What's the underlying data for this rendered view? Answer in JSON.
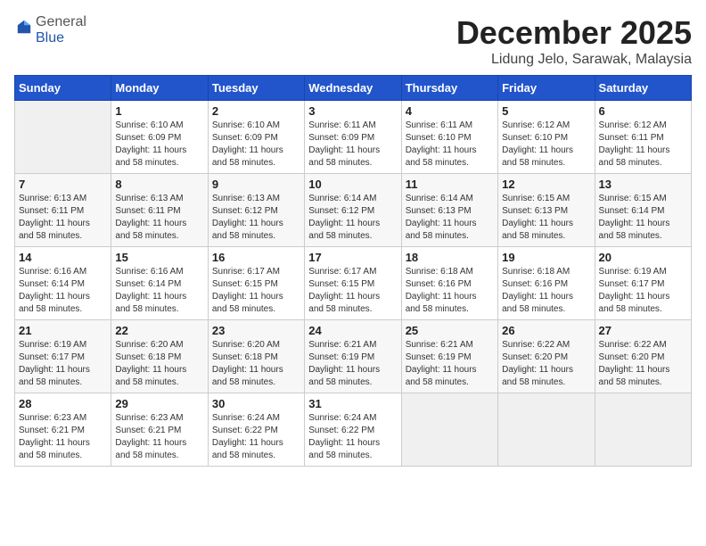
{
  "logo": {
    "general": "General",
    "blue": "Blue"
  },
  "title": "December 2025",
  "location": "Lidung Jelo, Sarawak, Malaysia",
  "days_of_week": [
    "Sunday",
    "Monday",
    "Tuesday",
    "Wednesday",
    "Thursday",
    "Friday",
    "Saturday"
  ],
  "weeks": [
    [
      {
        "day": "",
        "sunrise": "",
        "sunset": "",
        "daylight": ""
      },
      {
        "day": "1",
        "sunrise": "Sunrise: 6:10 AM",
        "sunset": "Sunset: 6:09 PM",
        "daylight": "Daylight: 11 hours and 58 minutes."
      },
      {
        "day": "2",
        "sunrise": "Sunrise: 6:10 AM",
        "sunset": "Sunset: 6:09 PM",
        "daylight": "Daylight: 11 hours and 58 minutes."
      },
      {
        "day": "3",
        "sunrise": "Sunrise: 6:11 AM",
        "sunset": "Sunset: 6:09 PM",
        "daylight": "Daylight: 11 hours and 58 minutes."
      },
      {
        "day": "4",
        "sunrise": "Sunrise: 6:11 AM",
        "sunset": "Sunset: 6:10 PM",
        "daylight": "Daylight: 11 hours and 58 minutes."
      },
      {
        "day": "5",
        "sunrise": "Sunrise: 6:12 AM",
        "sunset": "Sunset: 6:10 PM",
        "daylight": "Daylight: 11 hours and 58 minutes."
      },
      {
        "day": "6",
        "sunrise": "Sunrise: 6:12 AM",
        "sunset": "Sunset: 6:11 PM",
        "daylight": "Daylight: 11 hours and 58 minutes."
      }
    ],
    [
      {
        "day": "7",
        "sunrise": "Sunrise: 6:13 AM",
        "sunset": "Sunset: 6:11 PM",
        "daylight": "Daylight: 11 hours and 58 minutes."
      },
      {
        "day": "8",
        "sunrise": "Sunrise: 6:13 AM",
        "sunset": "Sunset: 6:11 PM",
        "daylight": "Daylight: 11 hours and 58 minutes."
      },
      {
        "day": "9",
        "sunrise": "Sunrise: 6:13 AM",
        "sunset": "Sunset: 6:12 PM",
        "daylight": "Daylight: 11 hours and 58 minutes."
      },
      {
        "day": "10",
        "sunrise": "Sunrise: 6:14 AM",
        "sunset": "Sunset: 6:12 PM",
        "daylight": "Daylight: 11 hours and 58 minutes."
      },
      {
        "day": "11",
        "sunrise": "Sunrise: 6:14 AM",
        "sunset": "Sunset: 6:13 PM",
        "daylight": "Daylight: 11 hours and 58 minutes."
      },
      {
        "day": "12",
        "sunrise": "Sunrise: 6:15 AM",
        "sunset": "Sunset: 6:13 PM",
        "daylight": "Daylight: 11 hours and 58 minutes."
      },
      {
        "day": "13",
        "sunrise": "Sunrise: 6:15 AM",
        "sunset": "Sunset: 6:14 PM",
        "daylight": "Daylight: 11 hours and 58 minutes."
      }
    ],
    [
      {
        "day": "14",
        "sunrise": "Sunrise: 6:16 AM",
        "sunset": "Sunset: 6:14 PM",
        "daylight": "Daylight: 11 hours and 58 minutes."
      },
      {
        "day": "15",
        "sunrise": "Sunrise: 6:16 AM",
        "sunset": "Sunset: 6:14 PM",
        "daylight": "Daylight: 11 hours and 58 minutes."
      },
      {
        "day": "16",
        "sunrise": "Sunrise: 6:17 AM",
        "sunset": "Sunset: 6:15 PM",
        "daylight": "Daylight: 11 hours and 58 minutes."
      },
      {
        "day": "17",
        "sunrise": "Sunrise: 6:17 AM",
        "sunset": "Sunset: 6:15 PM",
        "daylight": "Daylight: 11 hours and 58 minutes."
      },
      {
        "day": "18",
        "sunrise": "Sunrise: 6:18 AM",
        "sunset": "Sunset: 6:16 PM",
        "daylight": "Daylight: 11 hours and 58 minutes."
      },
      {
        "day": "19",
        "sunrise": "Sunrise: 6:18 AM",
        "sunset": "Sunset: 6:16 PM",
        "daylight": "Daylight: 11 hours and 58 minutes."
      },
      {
        "day": "20",
        "sunrise": "Sunrise: 6:19 AM",
        "sunset": "Sunset: 6:17 PM",
        "daylight": "Daylight: 11 hours and 58 minutes."
      }
    ],
    [
      {
        "day": "21",
        "sunrise": "Sunrise: 6:19 AM",
        "sunset": "Sunset: 6:17 PM",
        "daylight": "Daylight: 11 hours and 58 minutes."
      },
      {
        "day": "22",
        "sunrise": "Sunrise: 6:20 AM",
        "sunset": "Sunset: 6:18 PM",
        "daylight": "Daylight: 11 hours and 58 minutes."
      },
      {
        "day": "23",
        "sunrise": "Sunrise: 6:20 AM",
        "sunset": "Sunset: 6:18 PM",
        "daylight": "Daylight: 11 hours and 58 minutes."
      },
      {
        "day": "24",
        "sunrise": "Sunrise: 6:21 AM",
        "sunset": "Sunset: 6:19 PM",
        "daylight": "Daylight: 11 hours and 58 minutes."
      },
      {
        "day": "25",
        "sunrise": "Sunrise: 6:21 AM",
        "sunset": "Sunset: 6:19 PM",
        "daylight": "Daylight: 11 hours and 58 minutes."
      },
      {
        "day": "26",
        "sunrise": "Sunrise: 6:22 AM",
        "sunset": "Sunset: 6:20 PM",
        "daylight": "Daylight: 11 hours and 58 minutes."
      },
      {
        "day": "27",
        "sunrise": "Sunrise: 6:22 AM",
        "sunset": "Sunset: 6:20 PM",
        "daylight": "Daylight: 11 hours and 58 minutes."
      }
    ],
    [
      {
        "day": "28",
        "sunrise": "Sunrise: 6:23 AM",
        "sunset": "Sunset: 6:21 PM",
        "daylight": "Daylight: 11 hours and 58 minutes."
      },
      {
        "day": "29",
        "sunrise": "Sunrise: 6:23 AM",
        "sunset": "Sunset: 6:21 PM",
        "daylight": "Daylight: 11 hours and 58 minutes."
      },
      {
        "day": "30",
        "sunrise": "Sunrise: 6:24 AM",
        "sunset": "Sunset: 6:22 PM",
        "daylight": "Daylight: 11 hours and 58 minutes."
      },
      {
        "day": "31",
        "sunrise": "Sunrise: 6:24 AM",
        "sunset": "Sunset: 6:22 PM",
        "daylight": "Daylight: 11 hours and 58 minutes."
      },
      {
        "day": "",
        "sunrise": "",
        "sunset": "",
        "daylight": ""
      },
      {
        "day": "",
        "sunrise": "",
        "sunset": "",
        "daylight": ""
      },
      {
        "day": "",
        "sunrise": "",
        "sunset": "",
        "daylight": ""
      }
    ]
  ]
}
